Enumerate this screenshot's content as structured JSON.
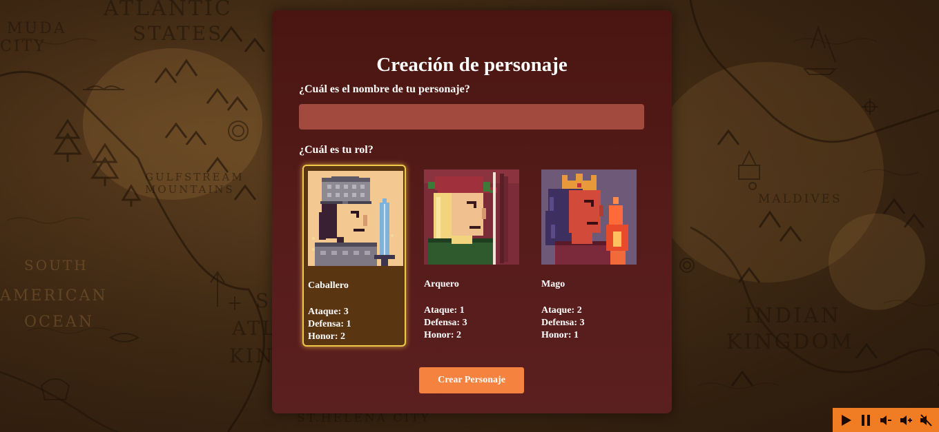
{
  "map": {
    "labels": [
      "ATLANTIC",
      "STATES",
      "MUDA",
      "CITY",
      "GULFSTREAM",
      "MOUNTAINS",
      "SOUTH",
      "AMERICAN",
      "OCEAN",
      "MALDIVES",
      "INDIAN",
      "KINGDOM",
      "ST.HELENA CITY",
      "SO",
      "ATL",
      "KIN"
    ]
  },
  "form": {
    "title": "Creación de personaje",
    "name_question": "¿Cuál es el nombre de tu personaje?",
    "name_value": "",
    "name_placeholder": "",
    "role_question": "¿Cuál es tu rol?",
    "submit_label": "Crear Personaje"
  },
  "roles": [
    {
      "name": "Caballero",
      "attack": "Ataque: 3",
      "defense": "Defensa: 1",
      "honor": "Honor: 2",
      "selected": true
    },
    {
      "name": "Arquero",
      "attack": "Ataque: 1",
      "defense": "Defensa: 3",
      "honor": "Honor: 2",
      "selected": false
    },
    {
      "name": "Mago",
      "attack": "Ataque: 2",
      "defense": "Defensa: 3",
      "honor": "Honor: 1",
      "selected": false
    }
  ],
  "audio_controls": [
    "play-icon",
    "pause-icon",
    "volume-down-icon",
    "volume-up-icon",
    "mute-icon"
  ],
  "colors": {
    "panel": "#561c1a",
    "input": "#a34a3f",
    "selected_border": "#f2c84b",
    "button": "#f5823f",
    "audio_bar": "#f07d23"
  }
}
